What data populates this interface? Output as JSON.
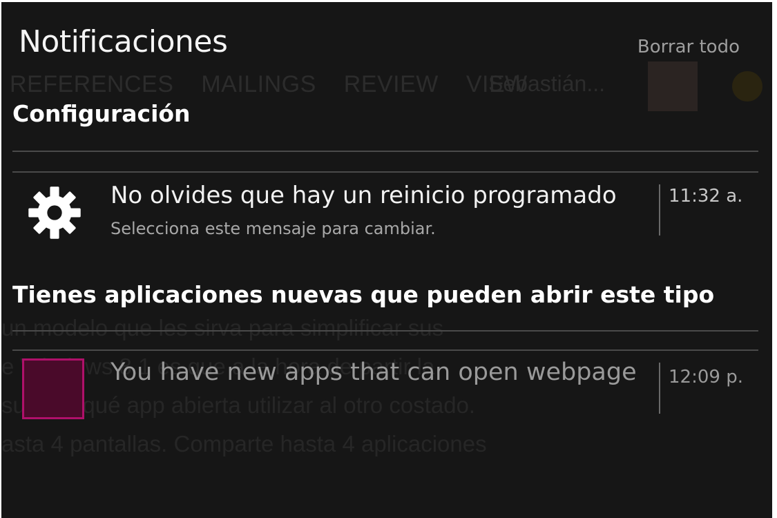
{
  "background_app": {
    "ribbon_tabs": [
      "REFERENCES",
      "MAILINGS",
      "REVIEW",
      "VIEW"
    ],
    "user_name": "Sebastián...",
    "document_lines": [
      "un modelo que les sirva para simplificar sus",
      "e    Windows 8.1 es que a  la hora de partir la",
      " sugiere qué app abierta utilizar al otro costado.",
      "asta 4 pantallas. Comparte hasta 4 aplicaciones"
    ]
  },
  "panel": {
    "title": "Notificaciones",
    "clear_all": "Borrar todo"
  },
  "groups": [
    {
      "header": "Configuración",
      "notifications": [
        {
          "icon": "gear-icon",
          "title": "No olvides que hay un reinicio programado",
          "body": "Selecciona este mensaje para cambiar.",
          "time": "11:32 a."
        }
      ]
    },
    {
      "header": "Tienes aplicaciones nuevas que pueden abrir este tipo",
      "notifications": [
        {
          "icon": "app-tile-icon",
          "title": "You have new apps that can open webpages",
          "time": "12:09 p."
        }
      ]
    }
  ],
  "colors": {
    "panel_bg": "#161616",
    "app_tile_border": "#b0106a",
    "app_tile_fill": "#4a0a2a"
  }
}
